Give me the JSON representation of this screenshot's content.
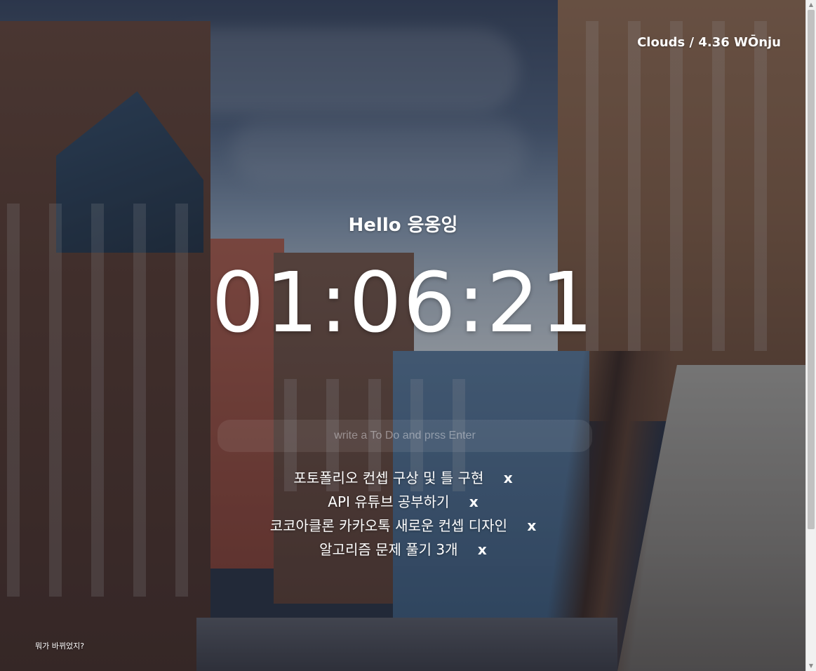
{
  "weather": {
    "text": "Clouds / 4.36 WŌnju"
  },
  "greeting": {
    "text": "Hello 응옹잉"
  },
  "clock": {
    "time": "01:06:21"
  },
  "todo": {
    "input_placeholder": "write a To Do and prss Enter",
    "input_value": "",
    "items": [
      {
        "text": "포토폴리오 컨셉 구상 및 틀 구현",
        "delete_label": "x"
      },
      {
        "text": "API 유튜브 공부하기",
        "delete_label": "x"
      },
      {
        "text": "코코아클론 카카오톡 새로운 컨셉 디자인",
        "delete_label": "x"
      },
      {
        "text": "알고리즘 문제 풀기 3개",
        "delete_label": "x"
      }
    ]
  },
  "footer": {
    "text": "뭐가 바뀌었지?"
  },
  "scrollbar": {
    "up_icon": "arrow-up-icon",
    "down_icon": "arrow-down-icon"
  },
  "background": {
    "description_icon": "city-street-photo"
  }
}
